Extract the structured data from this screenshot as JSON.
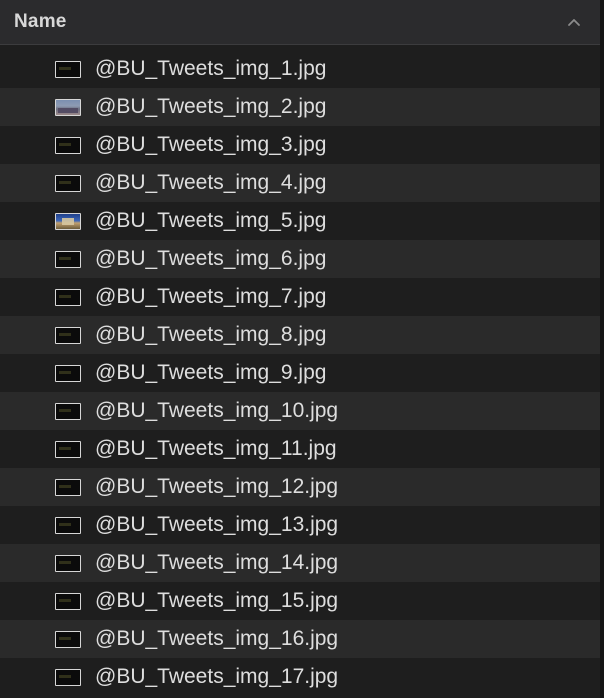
{
  "header": {
    "column_title": "Name",
    "sort_icon": "chevron-up-icon"
  },
  "files": [
    {
      "name": "@BU_Tweets_img_1.jpg",
      "thumb": "dark"
    },
    {
      "name": "@BU_Tweets_img_2.jpg",
      "thumb": "photo-city"
    },
    {
      "name": "@BU_Tweets_img_3.jpg",
      "thumb": "dark"
    },
    {
      "name": "@BU_Tweets_img_4.jpg",
      "thumb": "dark"
    },
    {
      "name": "@BU_Tweets_img_5.jpg",
      "thumb": "photo-building"
    },
    {
      "name": "@BU_Tweets_img_6.jpg",
      "thumb": "dark"
    },
    {
      "name": "@BU_Tweets_img_7.jpg",
      "thumb": "dark"
    },
    {
      "name": "@BU_Tweets_img_8.jpg",
      "thumb": "dark"
    },
    {
      "name": "@BU_Tweets_img_9.jpg",
      "thumb": "dark"
    },
    {
      "name": "@BU_Tweets_img_10.jpg",
      "thumb": "dark"
    },
    {
      "name": "@BU_Tweets_img_11.jpg",
      "thumb": "dark"
    },
    {
      "name": "@BU_Tweets_img_12.jpg",
      "thumb": "dark"
    },
    {
      "name": "@BU_Tweets_img_13.jpg",
      "thumb": "dark"
    },
    {
      "name": "@BU_Tweets_img_14.jpg",
      "thumb": "dark"
    },
    {
      "name": "@BU_Tweets_img_15.jpg",
      "thumb": "dark"
    },
    {
      "name": "@BU_Tweets_img_16.jpg",
      "thumb": "dark"
    },
    {
      "name": "@BU_Tweets_img_17.jpg",
      "thumb": "dark"
    }
  ],
  "colors": {
    "background": "#1e1e1e",
    "row_alt": "#2a2a2a",
    "header_bg": "#2b2b2d",
    "text": "#dedede"
  }
}
